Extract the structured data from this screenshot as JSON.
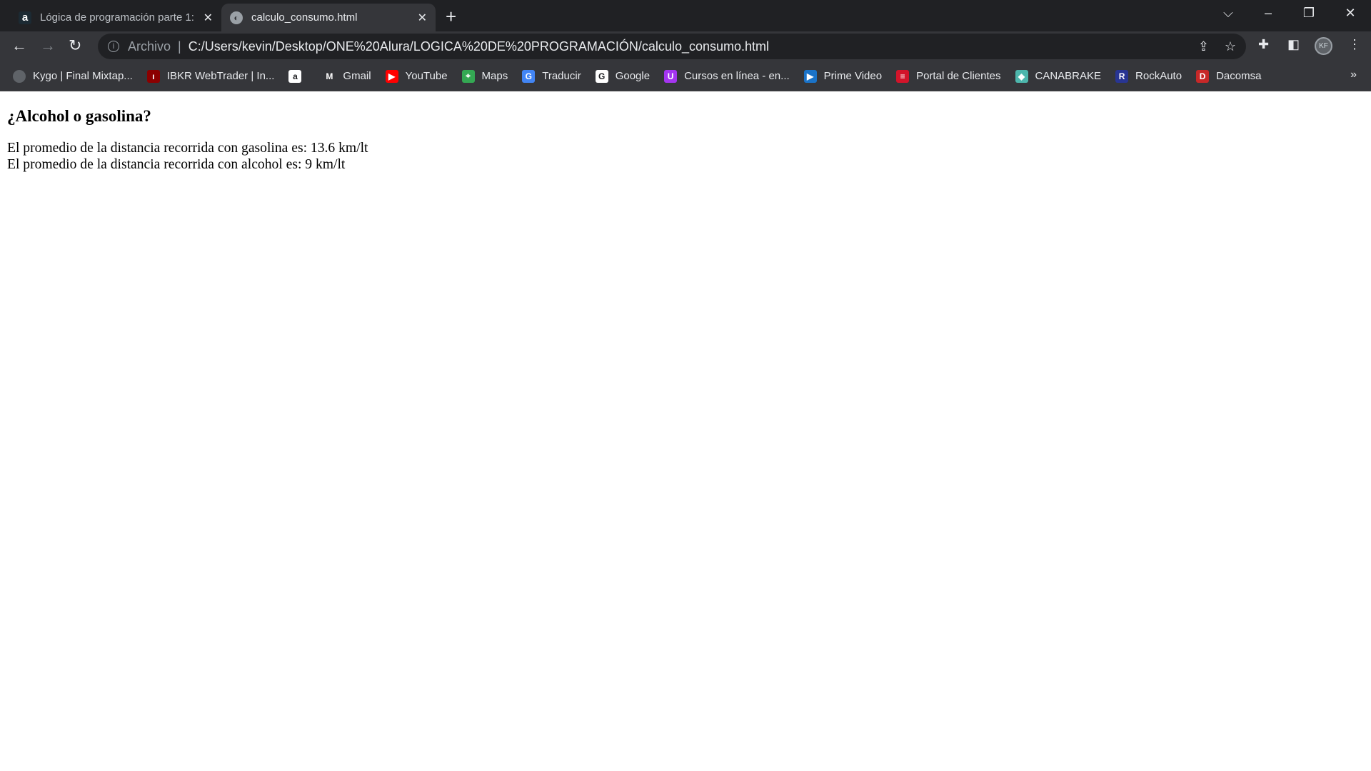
{
  "tabs": [
    {
      "title": "Lógica de programación parte 1:",
      "icon": "alura-icon",
      "active": false
    },
    {
      "title": "calculo_consumo.html",
      "icon": "globe-icon",
      "active": true
    }
  ],
  "toolbar": {
    "scheme": "Archivo",
    "url": "C:/Users/kevin/Desktop/ONE%20Alura/LOGICA%20DE%20PROGRAMACIÓN/calculo_consumo.html",
    "avatar": "KF"
  },
  "bookmarks": [
    {
      "label": "Kygo | Final Mixtap...",
      "icon": "globe-icon",
      "color": "#5f6368",
      "glyph": ""
    },
    {
      "label": "IBKR WebTrader | In...",
      "icon": "ibkr-icon",
      "color": "#8b0000",
      "glyph": "ı"
    },
    {
      "label": "",
      "icon": "amazon-icon",
      "color": "#ffffff",
      "glyph": "a"
    },
    {
      "label": "Gmail",
      "icon": "gmail-icon",
      "color": "#35363a",
      "glyph": "M"
    },
    {
      "label": "YouTube",
      "icon": "youtube-icon",
      "color": "#ff0000",
      "glyph": "▶"
    },
    {
      "label": "Maps",
      "icon": "maps-icon",
      "color": "#34a853",
      "glyph": "⌖"
    },
    {
      "label": "Traducir",
      "icon": "translate-icon",
      "color": "#4285f4",
      "glyph": "G"
    },
    {
      "label": "Google",
      "icon": "google-icon",
      "color": "#ffffff",
      "glyph": "G"
    },
    {
      "label": "Cursos en línea - en...",
      "icon": "udemy-icon",
      "color": "#a435f0",
      "glyph": "U"
    },
    {
      "label": "Prime Video",
      "icon": "prime-video-icon",
      "color": "#1a73c8",
      "glyph": "▶"
    },
    {
      "label": "Portal de Clientes",
      "icon": "portal-icon",
      "color": "#d2142a",
      "glyph": "≡"
    },
    {
      "label": "CANABRAKE",
      "icon": "canabrake-icon",
      "color": "#4db6ac",
      "glyph": "◆"
    },
    {
      "label": "RockAuto",
      "icon": "rockauto-icon",
      "color": "#283593",
      "glyph": "R"
    },
    {
      "label": "Dacomsa",
      "icon": "dacomsa-icon",
      "color": "#c62828",
      "glyph": "D"
    }
  ],
  "page": {
    "heading": "¿Alcohol o gasolina?",
    "lines": [
      "El promedio de la distancia recorrida con gasolina es: 13.6 km/lt",
      "El promedio de la distancia recorrida con alcohol es: 9 km/lt"
    ]
  }
}
